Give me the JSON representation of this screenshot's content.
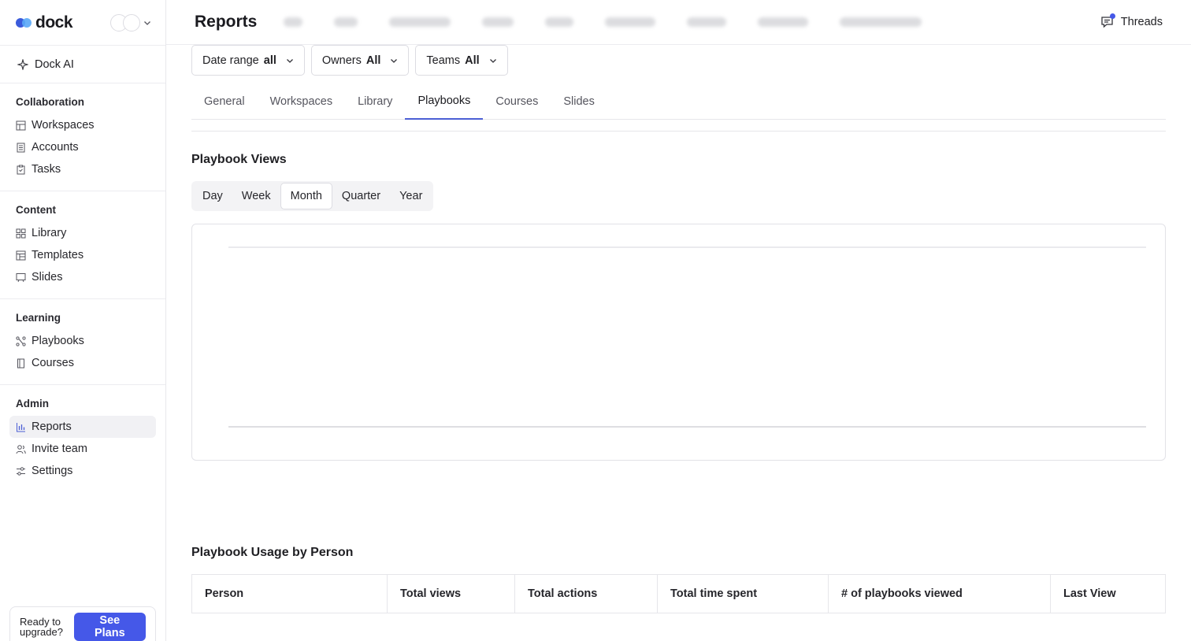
{
  "brand": {
    "name": "dock",
    "logo_icon": "dock-logo-icon",
    "accent": "#4558e8"
  },
  "sidebar": {
    "ai_label": "Dock AI",
    "sections": [
      {
        "title": "Collaboration",
        "items": [
          {
            "label": "Workspaces",
            "icon": "workspaces-icon"
          },
          {
            "label": "Accounts",
            "icon": "accounts-icon"
          },
          {
            "label": "Tasks",
            "icon": "tasks-icon"
          }
        ]
      },
      {
        "title": "Content",
        "items": [
          {
            "label": "Library",
            "icon": "library-icon"
          },
          {
            "label": "Templates",
            "icon": "templates-icon"
          },
          {
            "label": "Slides",
            "icon": "slides-icon"
          }
        ]
      },
      {
        "title": "Learning",
        "items": [
          {
            "label": "Playbooks",
            "icon": "playbooks-icon"
          },
          {
            "label": "Courses",
            "icon": "courses-icon"
          }
        ]
      },
      {
        "title": "Admin",
        "items": [
          {
            "label": "Reports",
            "icon": "reports-icon",
            "active": true
          },
          {
            "label": "Invite team",
            "icon": "invite-team-icon"
          },
          {
            "label": "Settings",
            "icon": "settings-icon"
          }
        ]
      }
    ],
    "upgrade": {
      "text": "Ready to upgrade?",
      "button": "See Plans"
    }
  },
  "header": {
    "title": "Reports",
    "threads_label": "Threads"
  },
  "filters": [
    {
      "label": "Date range",
      "value": "all"
    },
    {
      "label": "Owners",
      "value": "All"
    },
    {
      "label": "Teams",
      "value": "All"
    }
  ],
  "tabs": [
    "General",
    "Workspaces",
    "Library",
    "Playbooks",
    "Courses",
    "Slides"
  ],
  "active_tab": "Playbooks",
  "views": {
    "title": "Playbook Views",
    "periods": [
      "Day",
      "Week",
      "Month",
      "Quarter",
      "Year"
    ],
    "active_period": "Month"
  },
  "usage": {
    "title": "Playbook Usage by Person",
    "columns": [
      "Person",
      "Total views",
      "Total actions",
      "Total time spent",
      "# of playbooks viewed",
      "Last View"
    ]
  }
}
